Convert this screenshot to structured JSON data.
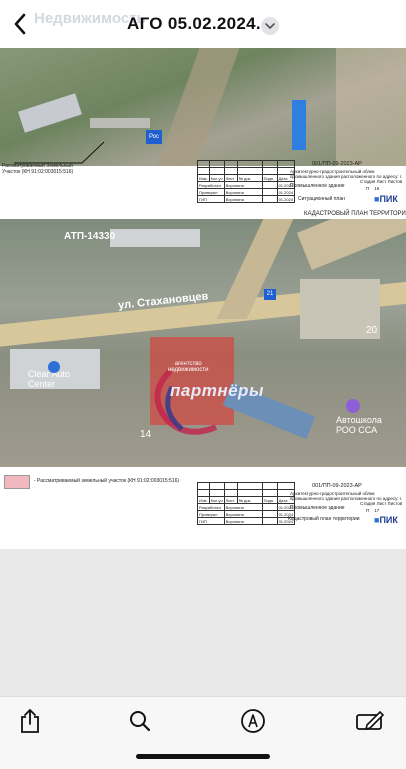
{
  "header": {
    "title": "АГО 05.02.2024.",
    "watermark": "Недвижимость"
  },
  "page1": {
    "code": "001/ПП-09-2023-АР",
    "description": "Архитектурно-градостроительный облик промышленного здания расположенного по адресу: г. Севастополь, ул. Индустриальная",
    "building": "Промышленное здание",
    "sheet_name": "Ситуационный план",
    "stage_header": [
      "Стадия",
      "Лист",
      "Листов"
    ],
    "stage_values": [
      "П",
      "16",
      ""
    ],
    "callout": "Рассматриваемый Земельный Участок (КН 91:02:003015:516)",
    "roles": [
      [
        "Разработал",
        "Воронина",
        "01.2024"
      ],
      [
        "Проверил",
        "Воронина",
        "01.2024"
      ],
      [
        "ГИП",
        "Воронина",
        "01.2024"
      ]
    ],
    "columns": [
      "Изм.",
      "Кол.уч",
      "Лист",
      "№ док.",
      "Подп.",
      "Дата"
    ],
    "logo": "ПИК",
    "map_label": "Рос"
  },
  "page2": {
    "header": "КАДАСТРОВЫЙ ПЛАН ТЕРРИТОРИ",
    "street": "ул. Стахановцев",
    "labels": {
      "atp": "АТП-14330",
      "auto": "Clear Auto\nCenter",
      "school": "Автошкола\nРОО ССА",
      "number_14": "14",
      "number_20": "20",
      "number_21": "21"
    },
    "watermark_small": "агентство\nнедвижимости",
    "watermark_big": "партнёры",
    "legend": "- Рассматриваемый земельный участок (КН 91:02:003015:516)",
    "code": "001/ПП-09-2023-АР",
    "description": "Архитектурно-градостроительный облик промышленного здания расположенного по адресу: г. Севастополь, ул. Индустриальная",
    "building": "Промышленное здание",
    "sheet_name": "Кадастровый план территории",
    "stage_header": [
      "Стадия",
      "Лист",
      "Листов"
    ],
    "stage_values": [
      "П",
      "17",
      ""
    ],
    "roles": [
      [
        "Разработал",
        "Воронина",
        "01.2024"
      ],
      [
        "Проверил",
        "Воронина",
        "01.2024"
      ],
      [
        "ГИП",
        "Воронина",
        "01.2024"
      ]
    ],
    "logo": "ПИК"
  },
  "toolbar": {
    "items": [
      "share-icon",
      "search-icon",
      "markup-icon",
      "annotate-icon"
    ]
  },
  "colors": {
    "accent": "#2f6fd6",
    "plot": "#e8302c",
    "legend_fill": "#f3b7bf"
  }
}
